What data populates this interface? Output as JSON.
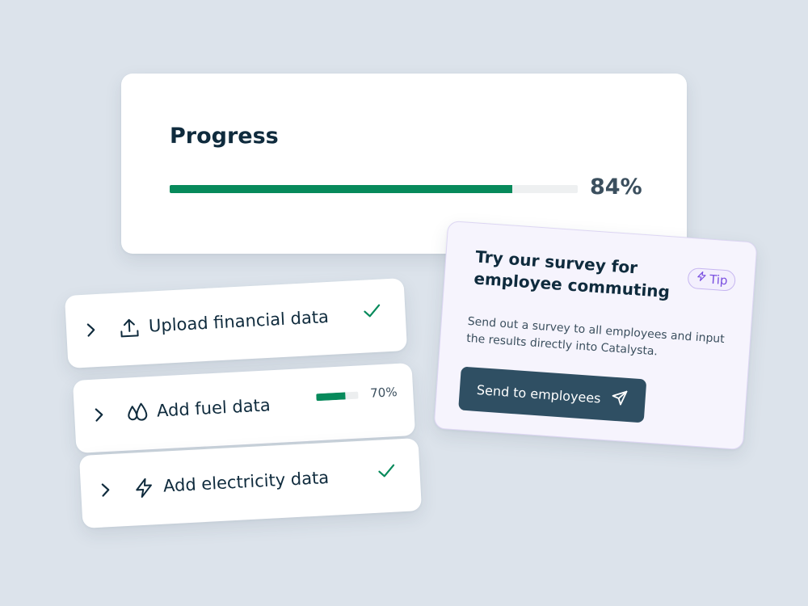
{
  "progress": {
    "title": "Progress",
    "value_label": "84%",
    "percent": 84
  },
  "tasks": [
    {
      "label": "Upload financial data",
      "icon": "upload-icon",
      "status": "done"
    },
    {
      "label": "Add fuel data",
      "icon": "droplets-icon",
      "status": "in-progress",
      "percent": 70,
      "percent_label": "70%"
    },
    {
      "label": "Add electricity data",
      "icon": "lightning-icon",
      "status": "done"
    }
  ],
  "tip": {
    "title": "Try our survey for employee commuting",
    "badge": "Tip",
    "text": "Send out a survey to all employees and input the results directly into Catalysta.",
    "button_label": "Send to employees"
  },
  "colors": {
    "accent_green": "#078a5b",
    "button_bg": "#2f4f63",
    "tip_purple": "#7a4fe0"
  }
}
